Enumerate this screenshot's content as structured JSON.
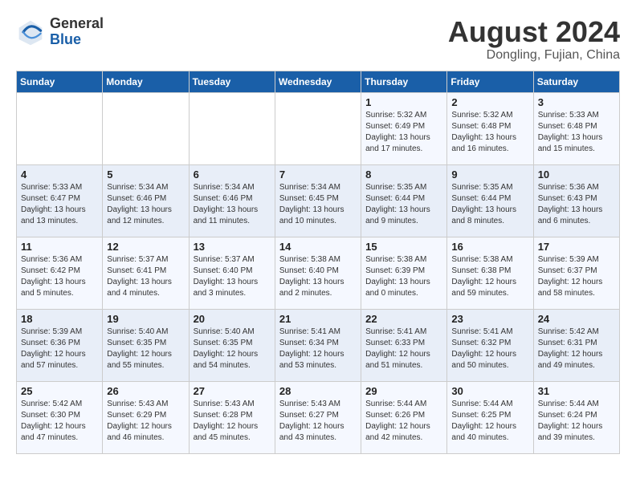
{
  "logo": {
    "general": "General",
    "blue": "Blue"
  },
  "header": {
    "month_year": "August 2024",
    "location": "Dongling, Fujian, China"
  },
  "weekdays": [
    "Sunday",
    "Monday",
    "Tuesday",
    "Wednesday",
    "Thursday",
    "Friday",
    "Saturday"
  ],
  "weeks": [
    [
      {
        "day": "",
        "info": ""
      },
      {
        "day": "",
        "info": ""
      },
      {
        "day": "",
        "info": ""
      },
      {
        "day": "",
        "info": ""
      },
      {
        "day": "1",
        "info": "Sunrise: 5:32 AM\nSunset: 6:49 PM\nDaylight: 13 hours\nand 17 minutes."
      },
      {
        "day": "2",
        "info": "Sunrise: 5:32 AM\nSunset: 6:48 PM\nDaylight: 13 hours\nand 16 minutes."
      },
      {
        "day": "3",
        "info": "Sunrise: 5:33 AM\nSunset: 6:48 PM\nDaylight: 13 hours\nand 15 minutes."
      }
    ],
    [
      {
        "day": "4",
        "info": "Sunrise: 5:33 AM\nSunset: 6:47 PM\nDaylight: 13 hours\nand 13 minutes."
      },
      {
        "day": "5",
        "info": "Sunrise: 5:34 AM\nSunset: 6:46 PM\nDaylight: 13 hours\nand 12 minutes."
      },
      {
        "day": "6",
        "info": "Sunrise: 5:34 AM\nSunset: 6:46 PM\nDaylight: 13 hours\nand 11 minutes."
      },
      {
        "day": "7",
        "info": "Sunrise: 5:34 AM\nSunset: 6:45 PM\nDaylight: 13 hours\nand 10 minutes."
      },
      {
        "day": "8",
        "info": "Sunrise: 5:35 AM\nSunset: 6:44 PM\nDaylight: 13 hours\nand 9 minutes."
      },
      {
        "day": "9",
        "info": "Sunrise: 5:35 AM\nSunset: 6:44 PM\nDaylight: 13 hours\nand 8 minutes."
      },
      {
        "day": "10",
        "info": "Sunrise: 5:36 AM\nSunset: 6:43 PM\nDaylight: 13 hours\nand 6 minutes."
      }
    ],
    [
      {
        "day": "11",
        "info": "Sunrise: 5:36 AM\nSunset: 6:42 PM\nDaylight: 13 hours\nand 5 minutes."
      },
      {
        "day": "12",
        "info": "Sunrise: 5:37 AM\nSunset: 6:41 PM\nDaylight: 13 hours\nand 4 minutes."
      },
      {
        "day": "13",
        "info": "Sunrise: 5:37 AM\nSunset: 6:40 PM\nDaylight: 13 hours\nand 3 minutes."
      },
      {
        "day": "14",
        "info": "Sunrise: 5:38 AM\nSunset: 6:40 PM\nDaylight: 13 hours\nand 2 minutes."
      },
      {
        "day": "15",
        "info": "Sunrise: 5:38 AM\nSunset: 6:39 PM\nDaylight: 13 hours\nand 0 minutes."
      },
      {
        "day": "16",
        "info": "Sunrise: 5:38 AM\nSunset: 6:38 PM\nDaylight: 12 hours\nand 59 minutes."
      },
      {
        "day": "17",
        "info": "Sunrise: 5:39 AM\nSunset: 6:37 PM\nDaylight: 12 hours\nand 58 minutes."
      }
    ],
    [
      {
        "day": "18",
        "info": "Sunrise: 5:39 AM\nSunset: 6:36 PM\nDaylight: 12 hours\nand 57 minutes."
      },
      {
        "day": "19",
        "info": "Sunrise: 5:40 AM\nSunset: 6:35 PM\nDaylight: 12 hours\nand 55 minutes."
      },
      {
        "day": "20",
        "info": "Sunrise: 5:40 AM\nSunset: 6:35 PM\nDaylight: 12 hours\nand 54 minutes."
      },
      {
        "day": "21",
        "info": "Sunrise: 5:41 AM\nSunset: 6:34 PM\nDaylight: 12 hours\nand 53 minutes."
      },
      {
        "day": "22",
        "info": "Sunrise: 5:41 AM\nSunset: 6:33 PM\nDaylight: 12 hours\nand 51 minutes."
      },
      {
        "day": "23",
        "info": "Sunrise: 5:41 AM\nSunset: 6:32 PM\nDaylight: 12 hours\nand 50 minutes."
      },
      {
        "day": "24",
        "info": "Sunrise: 5:42 AM\nSunset: 6:31 PM\nDaylight: 12 hours\nand 49 minutes."
      }
    ],
    [
      {
        "day": "25",
        "info": "Sunrise: 5:42 AM\nSunset: 6:30 PM\nDaylight: 12 hours\nand 47 minutes."
      },
      {
        "day": "26",
        "info": "Sunrise: 5:43 AM\nSunset: 6:29 PM\nDaylight: 12 hours\nand 46 minutes."
      },
      {
        "day": "27",
        "info": "Sunrise: 5:43 AM\nSunset: 6:28 PM\nDaylight: 12 hours\nand 45 minutes."
      },
      {
        "day": "28",
        "info": "Sunrise: 5:43 AM\nSunset: 6:27 PM\nDaylight: 12 hours\nand 43 minutes."
      },
      {
        "day": "29",
        "info": "Sunrise: 5:44 AM\nSunset: 6:26 PM\nDaylight: 12 hours\nand 42 minutes."
      },
      {
        "day": "30",
        "info": "Sunrise: 5:44 AM\nSunset: 6:25 PM\nDaylight: 12 hours\nand 40 minutes."
      },
      {
        "day": "31",
        "info": "Sunrise: 5:44 AM\nSunset: 6:24 PM\nDaylight: 12 hours\nand 39 minutes."
      }
    ]
  ]
}
